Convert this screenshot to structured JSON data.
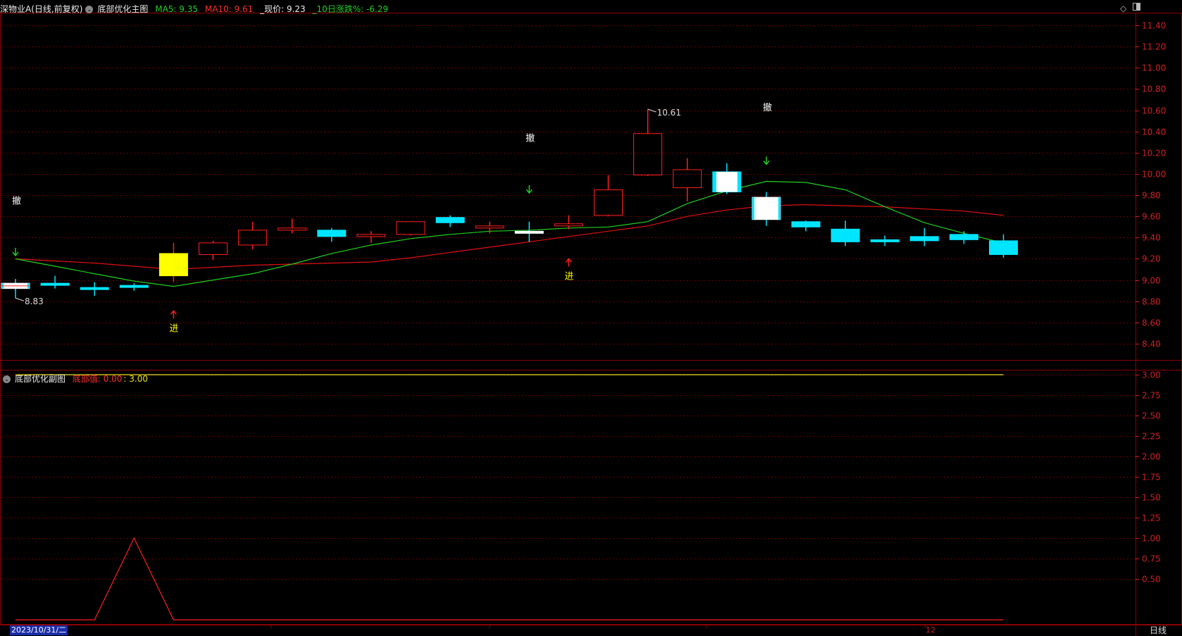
{
  "main_header": {
    "stock": "深物业A(日线,前复权)",
    "indicator": "底部优化主图",
    "ma5": "MA5: 9.35",
    "ma10": "MA10: 9.61",
    "price": "_现价: 9.23",
    "change10": "_10日涨跌%: -6.29"
  },
  "sub_header": {
    "indicator": "底部优化副图",
    "value_label": "底部值: 0.00",
    "value_extra": ": 3.00"
  },
  "colors": {
    "up": "#ff2020",
    "down": "#00e5ff",
    "ma5": "#20d020",
    "ma10": "#e01010",
    "grid": "#6a0000",
    "axis_text": "#cc2222"
  },
  "corner_icons": [
    "diamond-icon",
    "window-toggle-icon"
  ],
  "bottom": {
    "date": "2023/10/31/二",
    "month_label": "12",
    "period": "日线"
  },
  "chart_data": [
    {
      "type": "candlestick",
      "ylim": [
        8.3,
        11.5
      ],
      "y_ticks": [
        8.4,
        8.6,
        8.8,
        9.0,
        9.2,
        9.4,
        9.6,
        9.8,
        10.0,
        10.2,
        10.4,
        10.6,
        10.8,
        11.0,
        11.2,
        11.4
      ],
      "y_tick_labels": [
        "8.40",
        "8.60",
        "8.80",
        "9.00",
        "9.20",
        "9.40",
        "9.60",
        "9.80",
        "10.00",
        "10.20",
        "10.40",
        "10.60",
        "10.80",
        "11.00",
        "11.20",
        "11.40"
      ],
      "candles": [
        {
          "o": 8.97,
          "h": 9.01,
          "l": 8.83,
          "c": 8.92,
          "style": "white-solid"
        },
        {
          "o": 8.97,
          "h": 9.04,
          "l": 8.92,
          "c": 8.95,
          "style": "cyan"
        },
        {
          "o": 8.93,
          "h": 8.98,
          "l": 8.85,
          "c": 8.91,
          "style": "cyan"
        },
        {
          "o": 8.95,
          "h": 8.97,
          "l": 8.9,
          "c": 8.93,
          "style": "cyan"
        },
        {
          "o": 9.04,
          "h": 9.35,
          "l": 8.98,
          "c": 9.25,
          "style": "yellow-solid"
        },
        {
          "o": 9.24,
          "h": 9.37,
          "l": 9.19,
          "c": 9.35,
          "style": "red-hollow"
        },
        {
          "o": 9.33,
          "h": 9.55,
          "l": 9.29,
          "c": 9.47,
          "style": "red-hollow"
        },
        {
          "o": 9.49,
          "h": 9.58,
          "l": 9.44,
          "c": 9.49,
          "style": "red-hollow"
        },
        {
          "o": 9.47,
          "h": 9.49,
          "l": 9.36,
          "c": 9.41,
          "style": "cyan"
        },
        {
          "o": 9.42,
          "h": 9.46,
          "l": 9.35,
          "c": 9.43,
          "style": "red-hollow"
        },
        {
          "o": 9.43,
          "h": 9.55,
          "l": 9.42,
          "c": 9.55,
          "style": "red-hollow"
        },
        {
          "o": 9.59,
          "h": 9.61,
          "l": 9.5,
          "c": 9.54,
          "style": "cyan"
        },
        {
          "o": 9.51,
          "h": 9.55,
          "l": 9.44,
          "c": 9.5,
          "style": "red-hollow"
        },
        {
          "o": 9.46,
          "h": 9.55,
          "l": 9.36,
          "c": 9.45,
          "style": "white-solid"
        },
        {
          "o": 9.52,
          "h": 9.61,
          "l": 9.48,
          "c": 9.53,
          "style": "red-hollow"
        },
        {
          "o": 9.61,
          "h": 9.99,
          "l": 9.6,
          "c": 9.85,
          "style": "red-hollow"
        },
        {
          "o": 9.99,
          "h": 10.61,
          "l": 9.98,
          "c": 10.38,
          "style": "red-hollow"
        },
        {
          "o": 9.87,
          "h": 10.15,
          "l": 9.74,
          "c": 10.04,
          "style": "red-hollow"
        },
        {
          "o": 10.02,
          "h": 10.1,
          "l": 9.81,
          "c": 9.83,
          "style": "cyan"
        },
        {
          "o": 9.78,
          "h": 9.83,
          "l": 9.51,
          "c": 9.57,
          "style": "white-solid"
        },
        {
          "o": 9.55,
          "h": 9.56,
          "l": 9.46,
          "c": 9.5,
          "style": "cyan"
        },
        {
          "o": 9.48,
          "h": 9.56,
          "l": 9.32,
          "c": 9.36,
          "style": "cyan"
        },
        {
          "o": 9.38,
          "h": 9.42,
          "l": 9.32,
          "c": 9.36,
          "style": "cyan"
        },
        {
          "o": 9.41,
          "h": 9.49,
          "l": 9.32,
          "c": 9.37,
          "style": "cyan"
        },
        {
          "o": 9.43,
          "h": 9.46,
          "l": 9.34,
          "c": 9.38,
          "style": "cyan"
        },
        {
          "o": 9.37,
          "h": 9.43,
          "l": 9.21,
          "c": 9.24,
          "style": "cyan"
        }
      ],
      "ma5": [
        9.2,
        9.13,
        9.06,
        8.99,
        8.94,
        9.0,
        9.06,
        9.15,
        9.25,
        9.33,
        9.39,
        9.43,
        9.46,
        9.47,
        9.49,
        9.5,
        9.55,
        9.72,
        9.84,
        9.93,
        9.92,
        9.85,
        9.69,
        9.54,
        9.44,
        9.35
      ],
      "ma10": [
        9.2,
        9.18,
        9.16,
        9.13,
        9.1,
        9.12,
        9.14,
        9.15,
        9.16,
        9.17,
        9.21,
        9.26,
        9.31,
        9.36,
        9.41,
        9.46,
        9.51,
        9.6,
        9.66,
        9.7,
        9.71,
        9.7,
        9.69,
        9.67,
        9.65,
        9.61
      ],
      "annotations": [
        {
          "i": 0,
          "kind": "exit-arrow",
          "price": 9.25
        },
        {
          "i": 0,
          "kind": "exit-text",
          "price": 9.75,
          "text": "撤"
        },
        {
          "i": 0,
          "kind": "low-marker",
          "price": 8.83,
          "text": "8.83"
        },
        {
          "i": 4,
          "kind": "enter-arrow",
          "price": 8.69
        },
        {
          "i": 4,
          "kind": "enter-text",
          "price": 8.55,
          "text": "进"
        },
        {
          "i": 13,
          "kind": "exit-arrow",
          "price": 9.84
        },
        {
          "i": 13,
          "kind": "exit-text",
          "price": 10.34,
          "text": "撤"
        },
        {
          "i": 14,
          "kind": "enter-arrow",
          "price": 9.18
        },
        {
          "i": 14,
          "kind": "enter-text",
          "price": 9.04,
          "text": "进"
        },
        {
          "i": 16,
          "kind": "high-marker",
          "price": 10.61,
          "text": "10.61"
        },
        {
          "i": 19,
          "kind": "exit-arrow",
          "price": 10.11
        },
        {
          "i": 19,
          "kind": "exit-text",
          "price": 10.63,
          "text": "撤"
        }
      ]
    },
    {
      "type": "line",
      "ylim": [
        0,
        3.25
      ],
      "y_ticks": [
        0.5,
        0.75,
        1.0,
        1.25,
        1.5,
        1.75,
        2.0,
        2.25,
        2.5,
        2.75,
        3.0
      ],
      "y_tick_labels": [
        "0.50",
        "0.75",
        "1.00",
        "1.25",
        "1.50",
        "1.75",
        "2.00",
        "2.25",
        "2.50",
        "2.75",
        "3.00"
      ],
      "series": [
        {
          "name": "底部值",
          "values": [
            0,
            0,
            0,
            1,
            0,
            0,
            0,
            0,
            0,
            0,
            0,
            0,
            0,
            0,
            0,
            0,
            0,
            0,
            0,
            0,
            0,
            0,
            0,
            0,
            0,
            0
          ]
        },
        {
          "values": [
            3,
            3,
            3,
            3,
            3,
            3,
            3,
            3,
            3,
            3,
            3,
            3,
            3,
            3,
            3,
            3,
            3,
            3,
            3,
            3,
            3,
            3,
            3,
            3,
            3,
            3
          ]
        }
      ]
    }
  ]
}
